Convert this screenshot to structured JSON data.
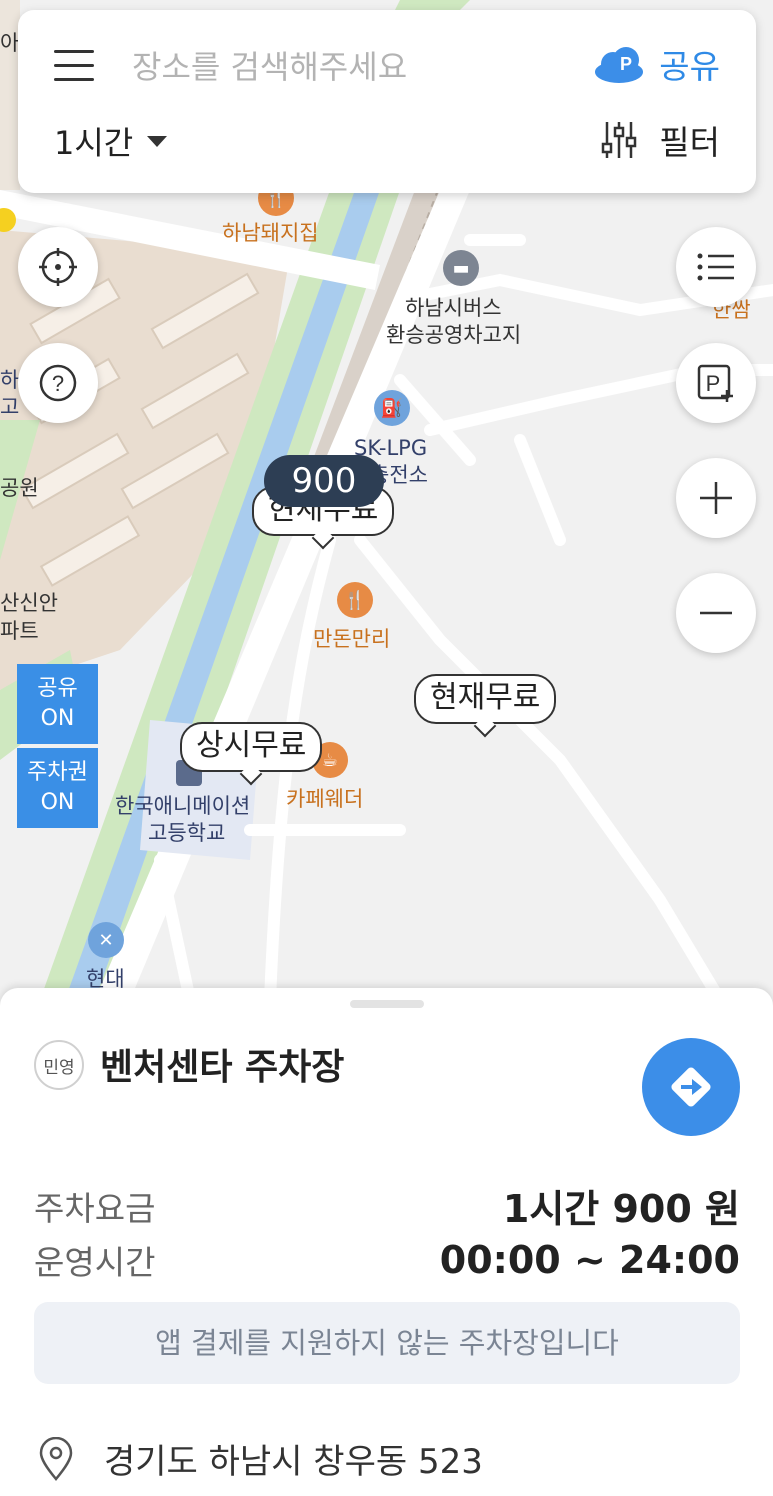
{
  "search": {
    "placeholder": "장소를 검색해주세요"
  },
  "header": {
    "share_label": "공유",
    "time_filter": "1시간",
    "filter_label": "필터"
  },
  "map_labels": {
    "hanam_pork": "하남돼지집",
    "bus_garage_1": "하남시버스",
    "bus_garage_2": "환승공영차고지",
    "sk_lpg_1": "SK-LPG",
    "sk_lpg_2": "충전소",
    "mandon": "만돈만리",
    "cafe": "카페웨더",
    "school_1": "한국애니메이션",
    "school_2": "고등학교",
    "hyundai": "현대",
    "left_ha": "하",
    "left_go": "고",
    "left_park": "공원",
    "left_apt_1": "산신안",
    "left_apt_2": "파트",
    "left_top": "아",
    "right_ssam": "한쌈"
  },
  "markers": {
    "price": "900",
    "free_now_1": "현재무료",
    "free_now_2": "현재무료",
    "always_free": "상시무료"
  },
  "toggles": {
    "share": [
      "공유",
      "ON"
    ],
    "ticket": [
      "주차권",
      "ON"
    ]
  },
  "sheet": {
    "kind": "민영",
    "name": "벤처센타 주차장",
    "fee_label": "주차요금",
    "fee_value": "1시간 900 원",
    "hours_label": "운영시간",
    "hours_value": "00:00 ~ 24:00",
    "notice": "앱 결제를 지원하지 않는 주차장입니다",
    "address": "경기도 하남시 창우동 523"
  },
  "colors": {
    "accent": "#3c8ee8",
    "price_marker": "#2d3e54",
    "toggle": "#3a8fe6"
  }
}
